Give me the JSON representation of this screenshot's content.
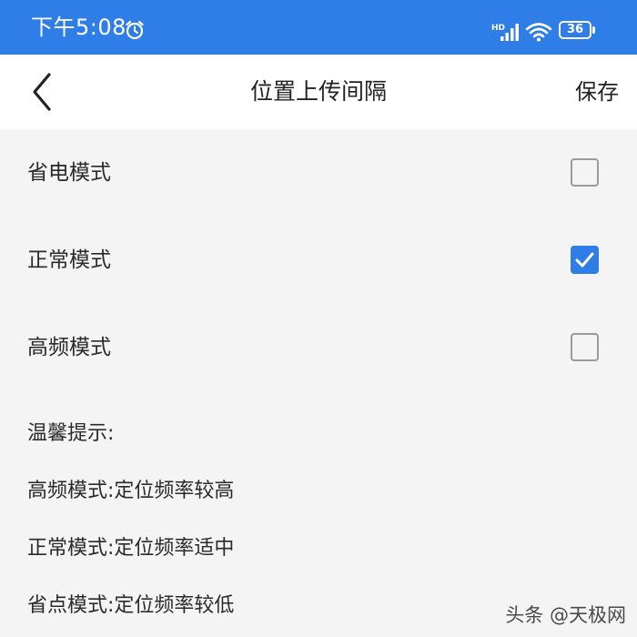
{
  "status_bar": {
    "time": "下午5:08",
    "battery": "36",
    "accent_color": "#2f7de7"
  },
  "header": {
    "title": "位置上传间隔",
    "save_label": "保存"
  },
  "modes": [
    {
      "label": "省电模式",
      "checked": false
    },
    {
      "label": "正常模式",
      "checked": true
    },
    {
      "label": "高频模式",
      "checked": false
    }
  ],
  "tips": {
    "heading": "温馨提示:",
    "lines": [
      "高频模式:定位频率较高",
      "正常模式:定位频率适中",
      "省点模式:定位频率较低"
    ]
  },
  "watermark": "头条 @天极网",
  "icons": {
    "back": "chevron-left-icon",
    "alarm": "alarm-icon",
    "signal": "signal-icon",
    "wifi": "wifi-icon",
    "battery": "battery-icon",
    "check": "check-icon"
  }
}
